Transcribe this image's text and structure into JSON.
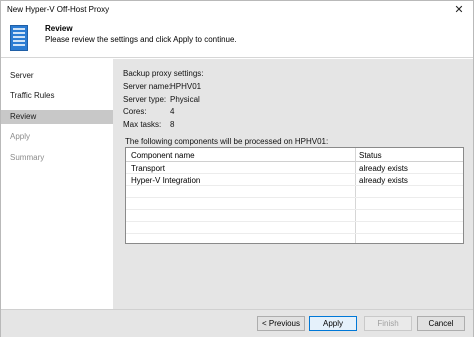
{
  "window": {
    "title": "New Hyper-V Off-Host Proxy",
    "close_glyph": "✕"
  },
  "header": {
    "title": "Review",
    "subtitle": "Please review the settings and click Apply to continue."
  },
  "sidebar": {
    "items": [
      {
        "label": "Server"
      },
      {
        "label": "Traffic Rules"
      },
      {
        "label": "Review"
      },
      {
        "label": "Apply"
      },
      {
        "label": "Summary"
      }
    ]
  },
  "review": {
    "section_label": "Backup proxy settings:",
    "fields": [
      {
        "label": "Server name:",
        "value": "HPHV01"
      },
      {
        "label": "Server type:",
        "value": "Physical"
      },
      {
        "label": "Cores:",
        "value": "4"
      },
      {
        "label": "Max tasks:",
        "value": "8"
      }
    ],
    "components_label": "The following components will be processed on HPHV01:",
    "columns": {
      "name": "Component name",
      "status": "Status"
    },
    "rows": [
      {
        "name": "Transport",
        "status": "already exists"
      },
      {
        "name": "Hyper-V Integration",
        "status": "already exists"
      }
    ]
  },
  "footer": {
    "previous": "< Previous",
    "apply": "Apply",
    "finish": "Finish",
    "cancel": "Cancel"
  }
}
